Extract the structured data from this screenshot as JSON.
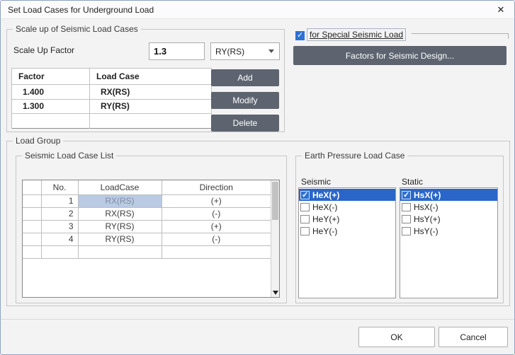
{
  "dialog": {
    "title": "Set Load Cases for Underground Load",
    "close_icon": "✕"
  },
  "colors": {
    "accent_blue": "#2d71d2",
    "selection_blue": "#2a66c8",
    "selected_cell_bg": "#b9cbe3",
    "dark_button": "#5d6470"
  },
  "scale_group": {
    "title": "Scale up of Seismic Load Cases",
    "factor_label": "Scale Up Factor",
    "factor_value": "1.3",
    "load_case_selected": "RY(RS)",
    "table": {
      "headers": [
        "Factor",
        "Load Case"
      ],
      "rows": [
        {
          "factor": "1.400",
          "load_case": "RX(RS)"
        },
        {
          "factor": "1.300",
          "load_case": "RY(RS)"
        }
      ]
    },
    "buttons": {
      "add": "Add",
      "modify": "Modify",
      "delete": "Delete"
    }
  },
  "special_seismic": {
    "checkbox_label": "for Special Seismic Load",
    "checked": true,
    "factors_button": "Factors for Seismic Design..."
  },
  "load_group": {
    "title": "Load Group",
    "seismic_list": {
      "title": "Seismic Load Case List",
      "headers": [
        "",
        "No.",
        "LoadCase",
        "Direction"
      ],
      "rows": [
        {
          "no": "1",
          "load_case": "RX(RS)",
          "direction": "(+)",
          "selected": true
        },
        {
          "no": "2",
          "load_case": "RX(RS)",
          "direction": "(-)",
          "selected": false
        },
        {
          "no": "3",
          "load_case": "RY(RS)",
          "direction": "(+)",
          "selected": false
        },
        {
          "no": "4",
          "load_case": "RY(RS)",
          "direction": "(-)",
          "selected": false
        }
      ]
    },
    "earth_pressure": {
      "title": "Earth Pressure Load Case",
      "seismic_label": "Seismic",
      "static_label": "Static",
      "seismic_items": [
        {
          "label": "HeX(+)",
          "checked": true,
          "selected": true
        },
        {
          "label": "HeX(-)",
          "checked": false,
          "selected": false
        },
        {
          "label": "HeY(+)",
          "checked": false,
          "selected": false
        },
        {
          "label": "HeY(-)",
          "checked": false,
          "selected": false
        }
      ],
      "static_items": [
        {
          "label": "HsX(+)",
          "checked": true,
          "selected": true
        },
        {
          "label": "HsX(-)",
          "checked": false,
          "selected": false
        },
        {
          "label": "HsY(+)",
          "checked": false,
          "selected": false
        },
        {
          "label": "HsY(-)",
          "checked": false,
          "selected": false
        }
      ]
    }
  },
  "footer": {
    "ok": "OK",
    "cancel": "Cancel"
  }
}
